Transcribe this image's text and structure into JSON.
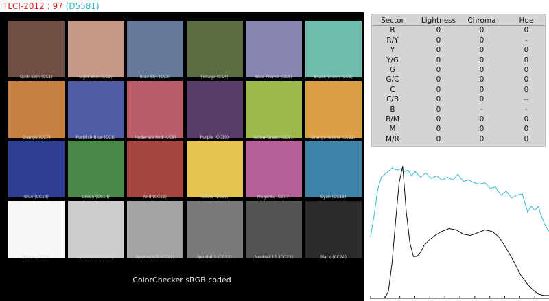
{
  "title": {
    "main": "TLCI-2012 : 97",
    "sub": "(D5581)"
  },
  "checker": {
    "caption": "ColorChecker sRGB coded",
    "patches": [
      {
        "label": "Dark Skin (CC1)",
        "color": "#6f4e43"
      },
      {
        "label": "Light Skin (CC2)",
        "color": "#c69888"
      },
      {
        "label": "Blue Sky (CC3)",
        "color": "#66799a"
      },
      {
        "label": "Foliage (CC4)",
        "color": "#5a6c40"
      },
      {
        "label": "Blue Flower (CC5)",
        "color": "#8985b2"
      },
      {
        "label": "Bluish Green (CC6)",
        "color": "#6fbcad"
      },
      {
        "label": "Orange (CC7)",
        "color": "#c88042"
      },
      {
        "label": "Purplish Blue (CC8)",
        "color": "#4d5ca4"
      },
      {
        "label": "Moderate Red (CC9)",
        "color": "#bb5d68"
      },
      {
        "label": "Purple (CC10)",
        "color": "#583d66"
      },
      {
        "label": "Yellow Green (CC11)",
        "color": "#9db84c"
      },
      {
        "label": "Orange Yellow (CC12)",
        "color": "#dc9e44"
      },
      {
        "label": "Blue (CC13)",
        "color": "#2f3f95"
      },
      {
        "label": "Green (CC14)",
        "color": "#4a8848"
      },
      {
        "label": "Red (CC15)",
        "color": "#a5453f"
      },
      {
        "label": "Yellow (CC16)",
        "color": "#e2c44e"
      },
      {
        "label": "Magenta (CC17)",
        "color": "#b55f99"
      },
      {
        "label": "Cyan (CC18)",
        "color": "#3f82a8"
      },
      {
        "label": "White (CC19)",
        "color": "#f8f8f8"
      },
      {
        "label": "Neutral 8 (CC20)",
        "color": "#cdcdcd"
      },
      {
        "label": "Neutral 6.5 (CC21)",
        "color": "#a3a3a3"
      },
      {
        "label": "Neutral 5 (CC22)",
        "color": "#7a7a7a"
      },
      {
        "label": "Neutral 3.5 (CC23)",
        "color": "#525252"
      },
      {
        "label": "Black (CC24)",
        "color": "#2b2b2b"
      }
    ]
  },
  "sector_table": {
    "headers": [
      "Sector",
      "Lightness",
      "Chroma",
      "Hue"
    ],
    "rows": [
      [
        "R",
        "0",
        "0",
        "0"
      ],
      [
        "R/Y",
        "0",
        "0",
        "-"
      ],
      [
        "Y",
        "0",
        "0",
        "0"
      ],
      [
        "Y/G",
        "0",
        "0",
        "0"
      ],
      [
        "G",
        "0",
        "0",
        "0"
      ],
      [
        "G/C",
        "0",
        "0",
        "0"
      ],
      [
        "C",
        "0",
        "0",
        "0"
      ],
      [
        "C/B",
        "0",
        "0",
        "--"
      ],
      [
        "B",
        "0",
        "-",
        "-"
      ],
      [
        "B/M",
        "0",
        "0",
        "0"
      ],
      [
        "M",
        "0",
        "0",
        "0"
      ],
      [
        "M/R",
        "0",
        "0",
        "0"
      ]
    ]
  },
  "chart_data": {
    "type": "line",
    "title": "",
    "xlabel": "",
    "ylabel": "",
    "xlim": [
      0,
      1
    ],
    "ylim": [
      0,
      1
    ],
    "series": [
      {
        "color": "#30bcd0",
        "x": [
          0,
          0.02,
          0.04,
          0.06,
          0.09,
          0.12,
          0.15,
          0.17,
          0.19,
          0.21,
          0.23,
          0.25,
          0.28,
          0.31,
          0.34,
          0.37,
          0.4,
          0.43,
          0.46,
          0.49,
          0.52,
          0.55,
          0.58,
          0.61,
          0.64,
          0.67,
          0.7,
          0.73,
          0.76,
          0.79,
          0.82,
          0.85,
          0.88,
          0.9,
          0.92,
          0.94,
          0.96,
          0.98,
          1.0
        ],
        "y": [
          0.44,
          0.6,
          0.78,
          0.87,
          0.9,
          0.935,
          0.92,
          0.93,
          0.91,
          0.92,
          0.88,
          0.91,
          0.87,
          0.9,
          0.86,
          0.88,
          0.85,
          0.87,
          0.85,
          0.89,
          0.84,
          0.85,
          0.83,
          0.82,
          0.83,
          0.79,
          0.8,
          0.74,
          0.77,
          0.72,
          0.74,
          0.75,
          0.62,
          0.66,
          0.63,
          0.66,
          0.58,
          0.52,
          0.48
        ]
      },
      {
        "color": "#101010",
        "x": [
          0,
          0.08,
          0.1,
          0.12,
          0.14,
          0.16,
          0.18,
          0.2,
          0.22,
          0.24,
          0.26,
          0.28,
          0.3,
          0.33,
          0.36,
          0.4,
          0.44,
          0.48,
          0.52,
          0.56,
          0.6,
          0.64,
          0.68,
          0.72,
          0.76,
          0.8,
          0.84,
          0.88,
          0.91,
          0.94,
          0.97,
          1.0
        ],
        "y": [
          0.0,
          0.0,
          0.05,
          0.25,
          0.55,
          0.83,
          0.95,
          0.62,
          0.4,
          0.3,
          0.3,
          0.33,
          0.38,
          0.42,
          0.45,
          0.48,
          0.5,
          0.49,
          0.46,
          0.45,
          0.47,
          0.49,
          0.48,
          0.44,
          0.36,
          0.27,
          0.17,
          0.1,
          0.06,
          0.03,
          0.02,
          0.02
        ]
      }
    ]
  }
}
